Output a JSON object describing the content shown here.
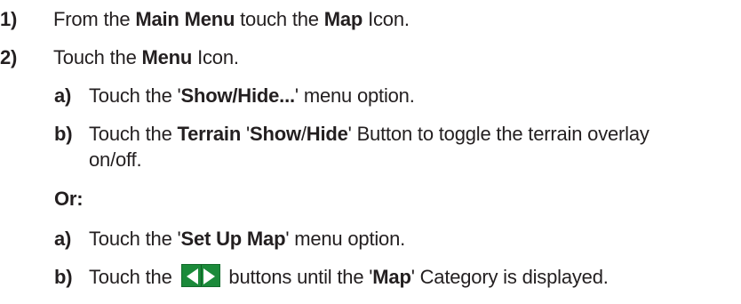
{
  "steps": [
    {
      "num": "1)",
      "parts": [
        "From the ",
        "Main Menu",
        " touch the ",
        "Map",
        " Icon."
      ]
    },
    {
      "num": "2)",
      "parts": [
        "Touch the ",
        "Menu",
        " Icon."
      ]
    }
  ],
  "substeps_a": [
    {
      "num": "a)",
      "parts": [
        "Touch the '",
        "Show/Hide...",
        "' menu option."
      ]
    },
    {
      "num": "b)",
      "parts": [
        "Touch the ",
        "Terrain",
        " '",
        "Show",
        "/",
        "Hide",
        "' Button to toggle the terrain overlay"
      ],
      "continuation": "on/off."
    }
  ],
  "or_label": "Or:",
  "substeps_b": [
    {
      "num": "a)",
      "parts": [
        "Touch the '",
        "Set Up Map",
        "' menu option."
      ]
    },
    {
      "num": "b)",
      "parts_before": [
        "Touch the "
      ],
      "icon": "left-right-arrows-icon",
      "parts_after": [
        " buttons until the '",
        "Map",
        "' Category is displayed."
      ]
    }
  ],
  "colors": {
    "text": "#231f20",
    "icon_bg": "#1b8a3a",
    "icon_arrow": "#ffffff"
  }
}
